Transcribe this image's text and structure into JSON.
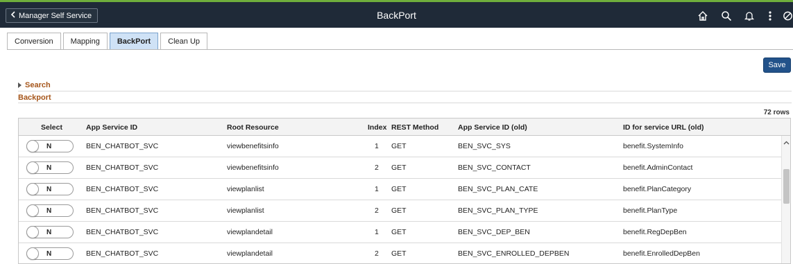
{
  "header": {
    "back_label": "Manager Self Service",
    "title": "BackPort",
    "icons": [
      "home-icon",
      "search-icon",
      "bell-icon",
      "kebab-menu-icon",
      "no-entry-icon"
    ]
  },
  "tabs": [
    {
      "label": "Conversion",
      "active": false
    },
    {
      "label": "Mapping",
      "active": false
    },
    {
      "label": "BackPort",
      "active": true
    },
    {
      "label": "Clean Up",
      "active": false
    }
  ],
  "toolbar": {
    "save_label": "Save"
  },
  "search": {
    "label": "Search"
  },
  "section": {
    "title": "Backport",
    "row_count": "72 rows"
  },
  "grid": {
    "columns": [
      "Select",
      "App Service ID",
      "Root Resource",
      "Index",
      "REST Method",
      "App Service ID (old)",
      "ID for service URL (old)"
    ],
    "rows": [
      {
        "select": "N",
        "app_service_id": "BEN_CHATBOT_SVC",
        "root_resource": "viewbenefitsinfo",
        "index": "1",
        "rest_method": "GET",
        "app_service_id_old": "BEN_SVC_SYS",
        "service_url_id_old": "benefit.SystemInfo"
      },
      {
        "select": "N",
        "app_service_id": "BEN_CHATBOT_SVC",
        "root_resource": "viewbenefitsinfo",
        "index": "2",
        "rest_method": "GET",
        "app_service_id_old": "BEN_SVC_CONTACT",
        "service_url_id_old": "benefit.AdminContact"
      },
      {
        "select": "N",
        "app_service_id": "BEN_CHATBOT_SVC",
        "root_resource": "viewplanlist",
        "index": "1",
        "rest_method": "GET",
        "app_service_id_old": "BEN_SVC_PLAN_CATE",
        "service_url_id_old": "benefit.PlanCategory"
      },
      {
        "select": "N",
        "app_service_id": "BEN_CHATBOT_SVC",
        "root_resource": "viewplanlist",
        "index": "2",
        "rest_method": "GET",
        "app_service_id_old": "BEN_SVC_PLAN_TYPE",
        "service_url_id_old": "benefit.PlanType"
      },
      {
        "select": "N",
        "app_service_id": "BEN_CHATBOT_SVC",
        "root_resource": "viewplandetail",
        "index": "1",
        "rest_method": "GET",
        "app_service_id_old": "BEN_SVC_DEP_BEN",
        "service_url_id_old": "benefit.RegDepBen"
      },
      {
        "select": "N",
        "app_service_id": "BEN_CHATBOT_SVC",
        "root_resource": "viewplandetail",
        "index": "2",
        "rest_method": "GET",
        "app_service_id_old": "BEN_SVC_ENROLLED_DEPBEN",
        "service_url_id_old": "benefit.EnrolledDepBen"
      }
    ]
  },
  "colors": {
    "banner": "#1f2a38",
    "accent_green": "#6fae3c",
    "active_tab": "#cfe2f6",
    "save_button": "#22528a",
    "section_title": "#a6561b"
  }
}
